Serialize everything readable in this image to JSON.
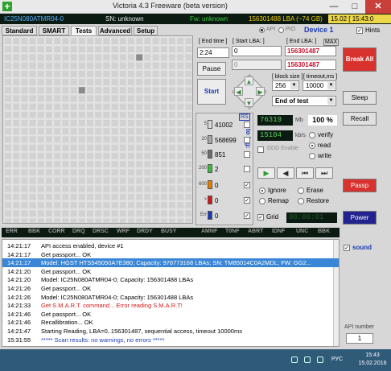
{
  "window": {
    "title": "Victoria 4.3 Freeware (beta version)",
    "icon": "plus-icon",
    "close_glyph": "✕",
    "max_glyph": "□",
    "min_glyph": "—"
  },
  "info": {
    "model": "IC25N080ATMR04-0",
    "sn": "SN: unknown",
    "fw": "Fw: unknown",
    "size": "156301488 LBA (~74 GB)",
    "date": "15.02  [ 15:43:0"
  },
  "tabs": [
    {
      "label": "Standard",
      "active": false
    },
    {
      "label": "SMART",
      "active": false
    },
    {
      "label": "Tests",
      "active": true
    },
    {
      "label": "Advanced",
      "active": false
    },
    {
      "label": "Setup",
      "active": false
    }
  ],
  "mode": {
    "api_label": "API",
    "pio_label": "PIO",
    "device": "Device 1",
    "hints_label": "Hints"
  },
  "lba": {
    "end_time_label": "[ End time ]",
    "end_time": "2:24",
    "start_label": "[ Start LBA: ]",
    "start_value": "0",
    "end_label": "[ End LBA: ]",
    "end_max": "MAX",
    "end_value": "156301487",
    "end_value2": "156301487",
    "disabled_value": "0"
  },
  "buttons": {
    "pause": "Pause",
    "start": "Start",
    "break_all": "Break All",
    "sleep": "Sleep",
    "recall": "Recall",
    "passp": "Passp",
    "power": "Power"
  },
  "params": {
    "block_size_label": "[ block size ]",
    "block_size": "256",
    "timeout_label": "[ timeout,ms ]",
    "timeout": "10000",
    "action": "End of test"
  },
  "stats": {
    "rs_label": "RS",
    "to_log_label": "to log:",
    "rows": [
      {
        "ms": "5",
        "value": "41002",
        "color": "#d9d9d9",
        "checked": false
      },
      {
        "ms": "20",
        "value": "568699",
        "color": "#a8a8a8",
        "checked": false
      },
      {
        "ms": "50",
        "value": "851",
        "color": "#6e6e6e",
        "checked": false
      },
      {
        "ms": "200",
        "value": "2",
        "color": "#3bbd3b",
        "checked": false
      },
      {
        "ms": "600",
        "value": "0",
        "color": "#e87c00",
        "checked": true
      },
      {
        "ms": ">",
        "value": "0",
        "color": "#d01818",
        "checked": true
      },
      {
        "ms": "Err",
        "value": "0",
        "color": "#1a3bb5",
        "checked": true
      }
    ]
  },
  "speed": {
    "mb": "76319",
    "mb_unit": "Mb",
    "percent": "100",
    "percent_sign": "%",
    "rate": "15104",
    "rate_unit": "kb/s",
    "ddd_label": "DDD Enable",
    "verify": "verify",
    "read": "read",
    "write": "write",
    "ignore": "Ignore",
    "erase": "Erase",
    "remap": "Remap",
    "restore": "Restore",
    "grid_label": "Grid",
    "grid_timer": "00:00:01"
  },
  "media_buttons": [
    "▶",
    "◀",
    "⏮",
    "⏭"
  ],
  "legend": [
    "ERR",
    "BBK",
    "CORR",
    "DRQ",
    "DRSC",
    "WRF",
    "DRDY",
    "BUSY",
    "AMNF",
    "T0NF",
    "ABRT",
    "IDNF",
    "UNC",
    "BBK"
  ],
  "log": [
    {
      "time": "14:21:17",
      "msg": "API access enabled, device #1",
      "type": "normal"
    },
    {
      "time": "14:21:17",
      "msg": "Get passport... OK",
      "type": "normal"
    },
    {
      "time": "14:21:17",
      "msg": "Model: HGST HTS545050A7E380; Capacity: 976773168 LBAs; SN: TM85014C0A2MDL; FW: GG2...",
      "type": "sel"
    },
    {
      "time": "14:21:20",
      "msg": "Get passport... OK",
      "type": "normal"
    },
    {
      "time": "14:21:20",
      "msg": "Model: IC25N080ATMR04-0; Capacity: 156301488 LBAs",
      "type": "normal"
    },
    {
      "time": "14:21:26",
      "msg": "Get passport... OK",
      "type": "normal"
    },
    {
      "time": "14:21:26",
      "msg": "Model: IC25N080ATMR04-0; Capacity: 156301488 LBAs",
      "type": "normal"
    },
    {
      "time": "14:21:33",
      "msg": "Get S.M.A.R.T. command... Error reading S.M.A.R.T!",
      "type": "err"
    },
    {
      "time": "14:21:46",
      "msg": "Get passport... OK",
      "type": "normal"
    },
    {
      "time": "14:21:46",
      "msg": "Recallibration... OK",
      "type": "normal"
    },
    {
      "time": "14:21:47",
      "msg": "Starting Reading, LBA=0..156301487, sequential access, timeout 10000ms",
      "type": "normal"
    },
    {
      "time": "15:31:55",
      "msg": "***** Scan results: no warnings, no errors *****",
      "type": "blue"
    }
  ],
  "side": {
    "sound_label": "sound",
    "api_number_label": "API number",
    "api_number": "1"
  },
  "taskbar": {
    "lang": "РУС",
    "time": "15:43",
    "date": "15.02.2016"
  }
}
